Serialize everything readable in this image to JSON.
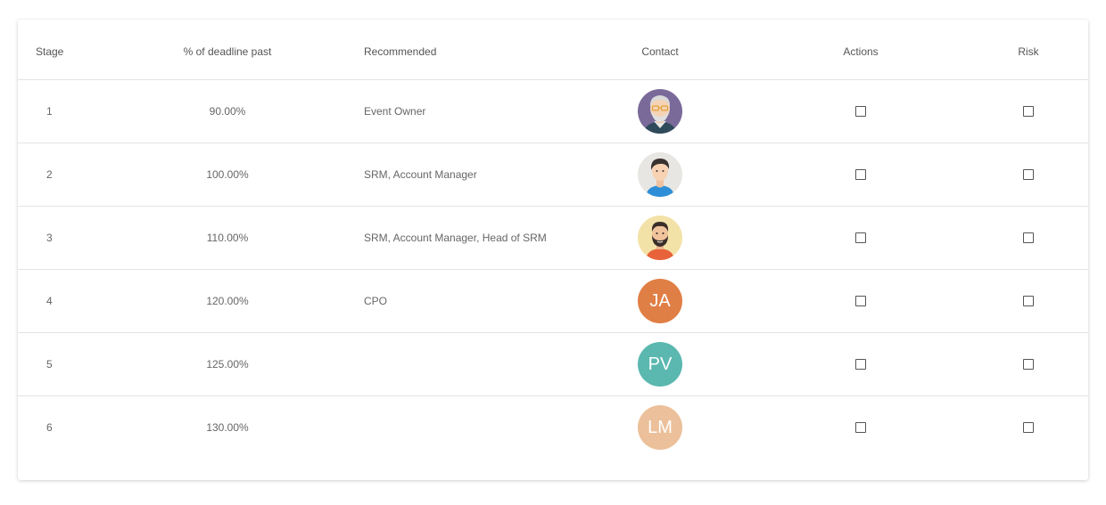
{
  "table": {
    "headers": {
      "stage": "Stage",
      "pct": "% of deadline past",
      "recommended": "Recommended",
      "contact": "Contact",
      "actions": "Actions",
      "risk": "Risk"
    },
    "rows": [
      {
        "stage": "1",
        "pct": "90.00%",
        "recommended": "Event Owner",
        "contact": {
          "type": "illustration",
          "icon": "old-man-glasses-avatar-icon",
          "bg": "#7a6a9a"
        },
        "actions_checked": false,
        "risk_checked": false
      },
      {
        "stage": "2",
        "pct": "100.00%",
        "recommended": "SRM, Account Manager",
        "contact": {
          "type": "illustration",
          "icon": "young-man-avatar-icon",
          "bg": "#e8e6e3"
        },
        "actions_checked": false,
        "risk_checked": false
      },
      {
        "stage": "3",
        "pct": "110.00%",
        "recommended": "SRM, Account Manager, Head of SRM",
        "contact": {
          "type": "illustration",
          "icon": "bearded-man-avatar-icon",
          "bg": "#f3e2a8"
        },
        "actions_checked": false,
        "risk_checked": false
      },
      {
        "stage": "4",
        "pct": "120.00%",
        "recommended": "CPO",
        "contact": {
          "type": "initials",
          "initials": "JA",
          "bg": "#e07f45"
        },
        "actions_checked": false,
        "risk_checked": false
      },
      {
        "stage": "5",
        "pct": "125.00%",
        "recommended": "",
        "contact": {
          "type": "initials",
          "initials": "PV",
          "bg": "#5bb8b0"
        },
        "actions_checked": false,
        "risk_checked": false
      },
      {
        "stage": "6",
        "pct": "130.00%",
        "recommended": "",
        "contact": {
          "type": "initials",
          "initials": "LM",
          "bg": "#ebc09a"
        },
        "actions_checked": false,
        "risk_checked": false
      }
    ]
  },
  "colors": {
    "text": "#666666",
    "header_text": "#555555",
    "divider": "#e4e4e4"
  }
}
